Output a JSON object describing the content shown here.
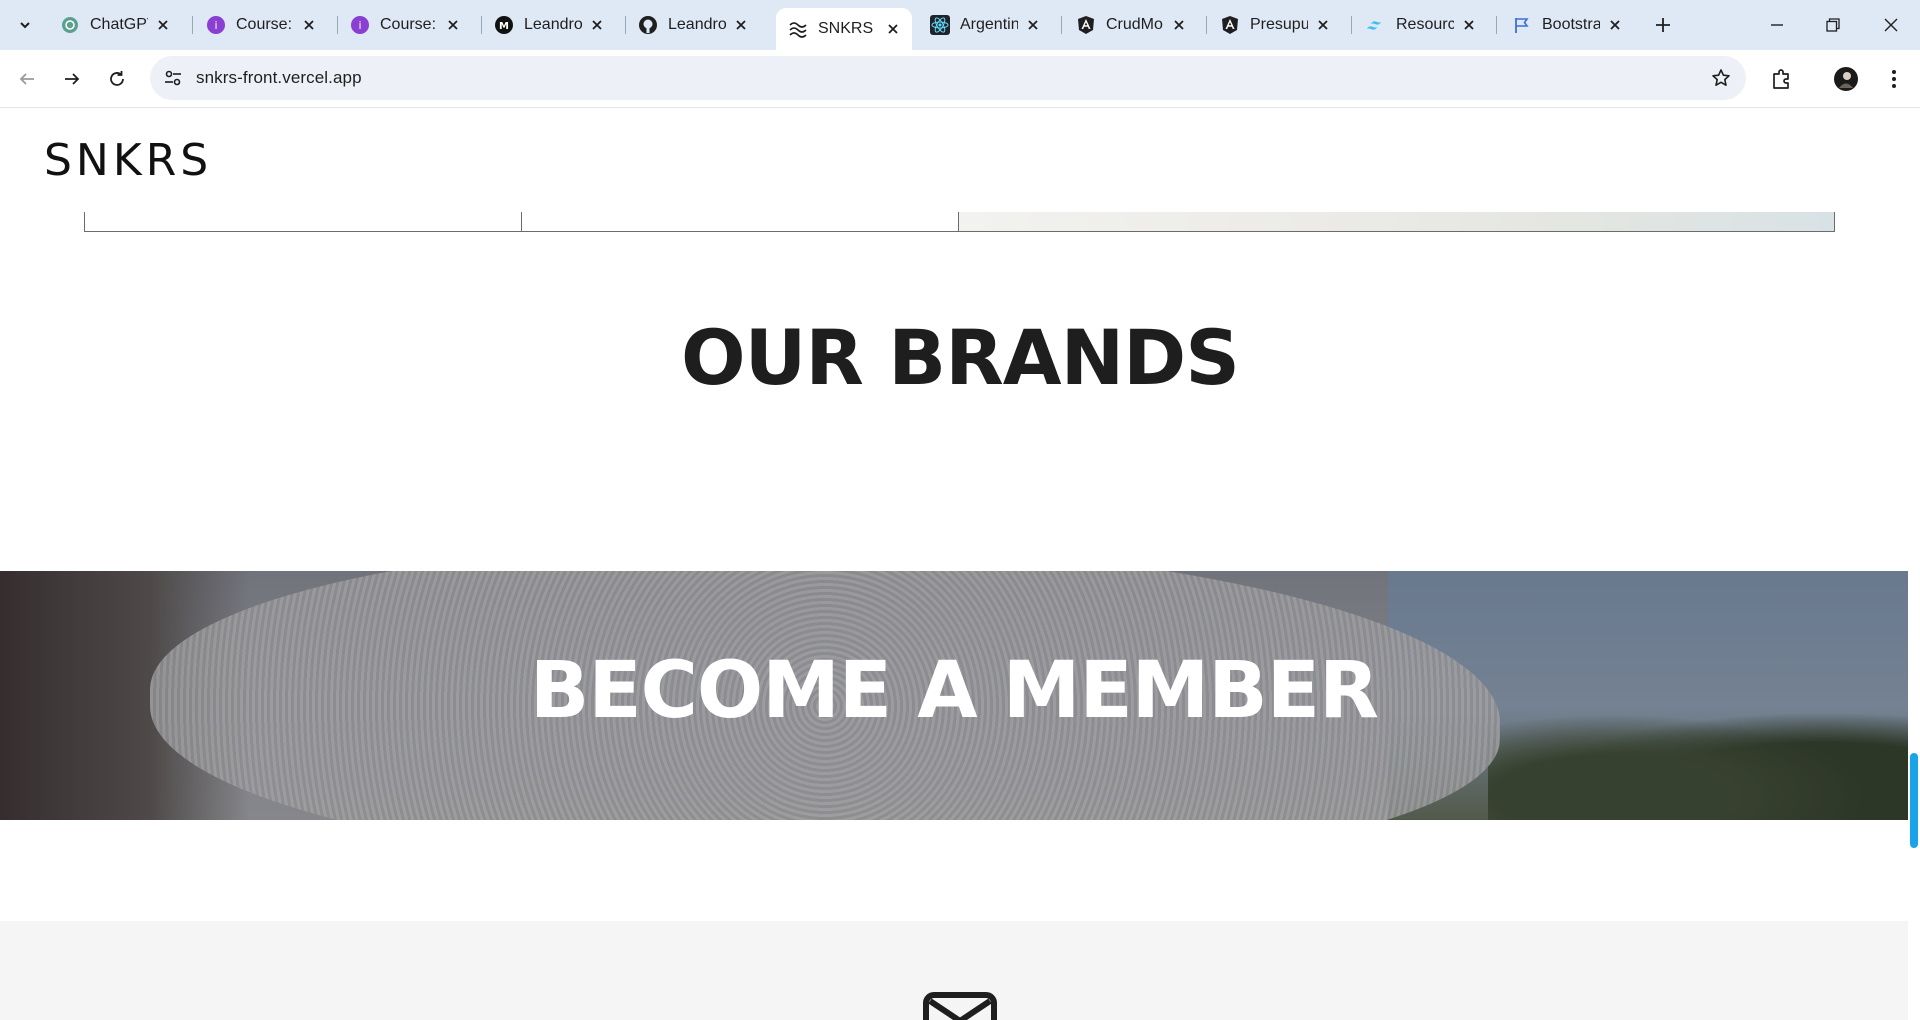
{
  "browser": {
    "tabs": [
      {
        "title": "ChatGPT",
        "icon": "chatgpt-icon"
      },
      {
        "title": "Course: ",
        "icon": "course-icon"
      },
      {
        "title": "Course: ",
        "icon": "course-icon"
      },
      {
        "title": "Leandro",
        "icon": "medium-icon"
      },
      {
        "title": "Leandro",
        "icon": "github-icon"
      },
      {
        "title": "SNKRS",
        "icon": "snkrs-icon"
      },
      {
        "title": "Argentin",
        "icon": "react-icon"
      },
      {
        "title": "CrudMo",
        "icon": "angular-icon"
      },
      {
        "title": "Presupu",
        "icon": "angular-icon"
      },
      {
        "title": "Resourc",
        "icon": "tailwind-icon"
      },
      {
        "title": "Bootstra",
        "icon": "flag-icon"
      }
    ],
    "active_tab_index": 5,
    "url": "snkrs-front.vercel.app",
    "accent_color": "#1aa3e8"
  },
  "page": {
    "logo": "SNKRS",
    "brands_heading": "OUR BRANDS",
    "member_heading": "BECOME A MEMBER"
  }
}
